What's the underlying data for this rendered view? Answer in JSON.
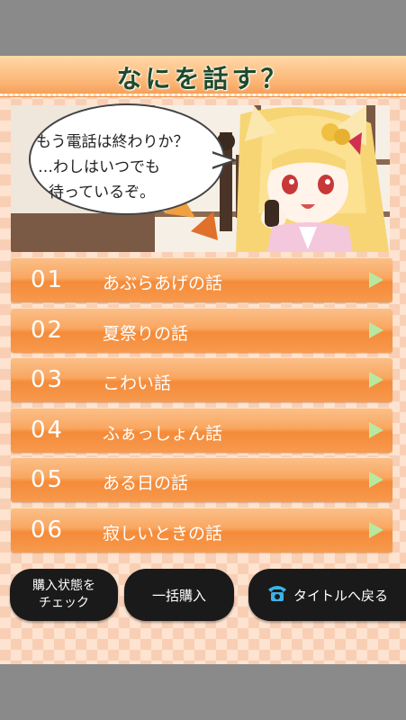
{
  "header": {
    "title": "なにを話す？"
  },
  "speech": {
    "lines": [
      "もう電話は終わりか？",
      "…わしはいつでも",
      "待っているぞ。"
    ]
  },
  "menu": {
    "items": [
      {
        "num": "01",
        "label": "あぶらあげの話"
      },
      {
        "num": "02",
        "label": "夏祭りの話"
      },
      {
        "num": "03",
        "label": "こわい話"
      },
      {
        "num": "04",
        "label": "ふぁっしょん話"
      },
      {
        "num": "05",
        "label": "ある日の話"
      },
      {
        "num": "06",
        "label": "寂しいときの話"
      }
    ]
  },
  "buttons": {
    "check_line1": "購入状態を",
    "check_line2": "チェック",
    "bulk": "一括購入",
    "back": "タイトルへ戻る"
  },
  "colors": {
    "accent": "#f48b39",
    "title": "#1f4a2a",
    "arrow": "#b8e8a0",
    "phone_icon": "#3bb3e6"
  }
}
